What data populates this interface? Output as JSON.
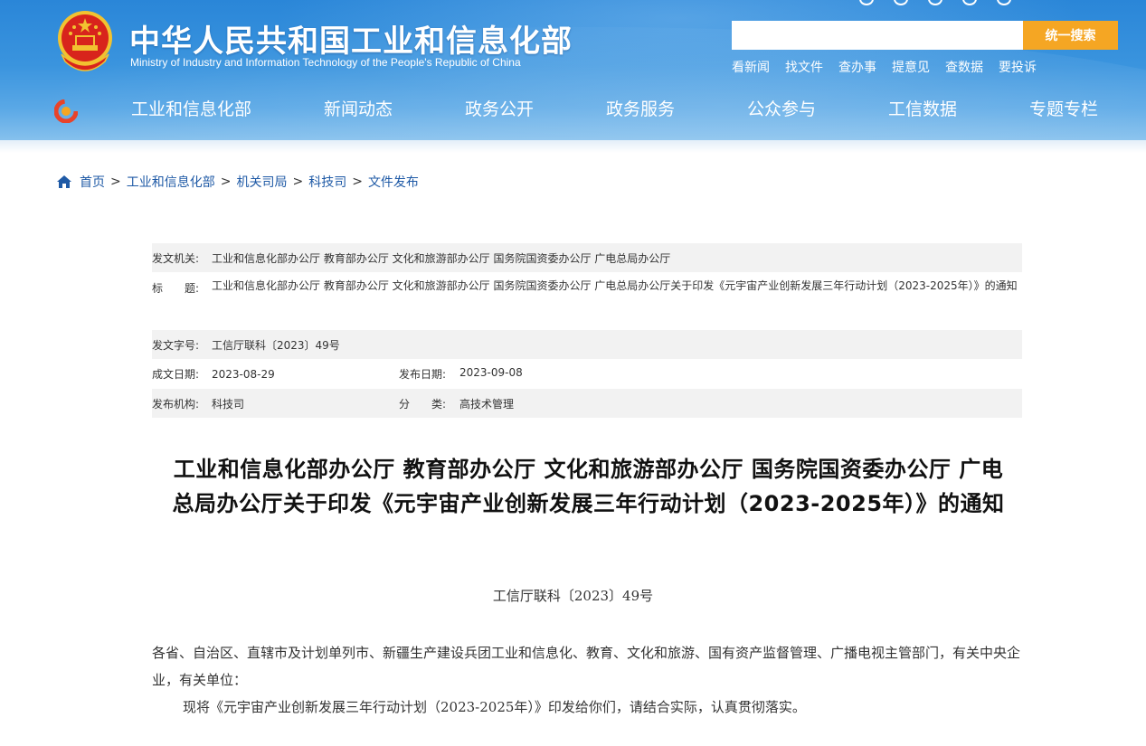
{
  "header": {
    "site_title": "中华人民共和国工业和信息化部",
    "site_subtitle": "Ministry of Industry and Information Technology of the People's Republic of China",
    "search_placeholder": "",
    "search_button": "统一搜索",
    "quick_links": [
      "看新闻",
      "找文件",
      "查办事",
      "提意见",
      "查数据",
      "要投诉"
    ]
  },
  "nav": {
    "items": [
      "工业和信息化部",
      "新闻动态",
      "政务公开",
      "政务服务",
      "公众参与",
      "工信数据",
      "专题专栏"
    ]
  },
  "breadcrumb": {
    "items": [
      "首页",
      "工业和信息化部",
      "机关司局",
      "科技司",
      "文件发布"
    ],
    "separator": ">"
  },
  "meta": {
    "issuer_label": "发文机关:",
    "issuer": "工业和信息化部办公厅 教育部办公厅 文化和旅游部办公厅 国务院国资委办公厅 广电总局办公厅",
    "title_label_1": "标",
    "title_label_2": "题:",
    "title": "工业和信息化部办公厅 教育部办公厅 文化和旅游部办公厅 国务院国资委办公厅 广电总局办公厅关于印发《元宇宙产业创新发展三年行动计划（2023-2025年）》的通知",
    "doc_number_label": "发文字号:",
    "doc_number": "工信厅联科〔2023〕49号",
    "written_date_label": "成文日期:",
    "written_date": "2023-08-29",
    "publish_date_label": "发布日期:",
    "publish_date": "2023-09-08",
    "publisher_label": "发布机构:",
    "publisher": "科技司",
    "category_label_1": "分",
    "category_label_2": "类:",
    "category": "高技术管理"
  },
  "article": {
    "title_line1": "工业和信息化部办公厅 教育部办公厅 文化和旅游部办公厅 国务院国资委办公厅 广电",
    "title_line2": "总局办公厅关于印发《元宇宙产业创新发展三年行动计划（2023-2025年）》的通知",
    "doc_no": "工信厅联科〔2023〕49号",
    "salutation": "各省、自治区、直辖市及计划单列市、新疆生产建设兵团工业和信息化、教育、文化和旅游、国有资产监督管理、广播电视主管部门，有关中央企业，有关单位：",
    "paragraph1": "现将《元宇宙产业创新发展三年行动计划（2023-2025年）》印发给你们，请结合实际，认真贯彻落实。"
  },
  "colors": {
    "header_blue": "#2a86d8",
    "search_button": "#f5a623",
    "link_blue": "#1f5aa6",
    "meta_shade": "#f2f2f2"
  },
  "icons": [
    "national-emblem",
    "home-icon",
    "site-logo-icon"
  ]
}
